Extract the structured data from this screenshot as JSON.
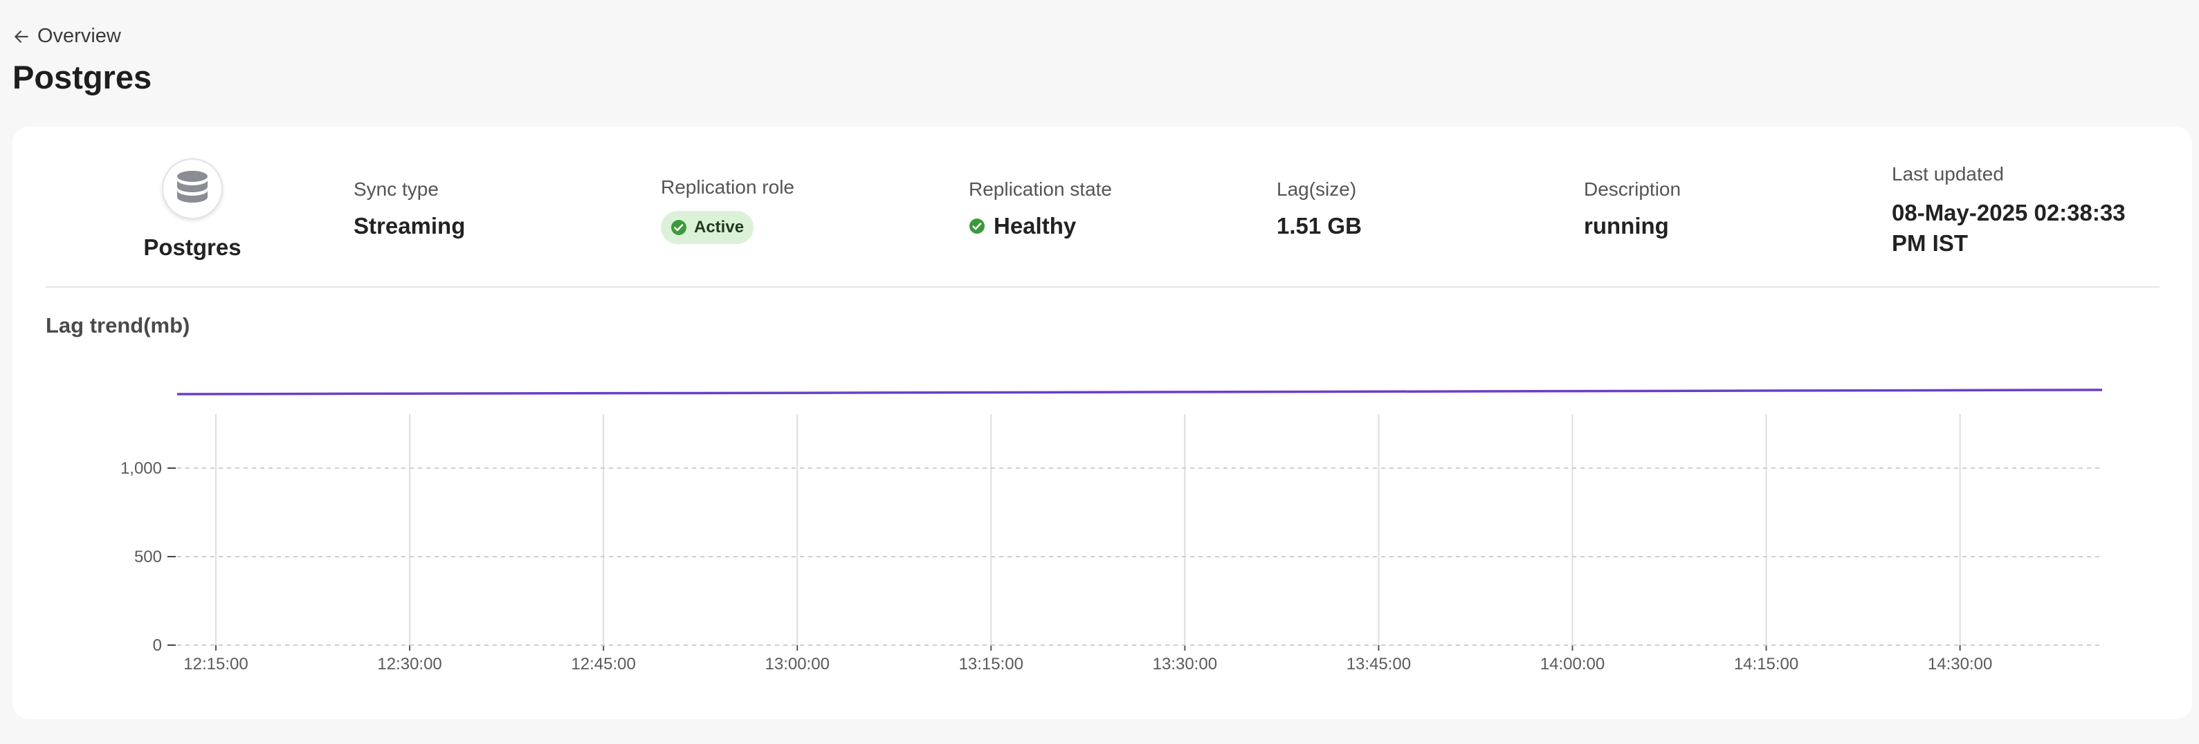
{
  "nav": {
    "back_label": "Overview"
  },
  "page": {
    "title": "Postgres"
  },
  "source": {
    "name": "Postgres",
    "icon": "database-icon"
  },
  "info": {
    "sync_type": {
      "label": "Sync type",
      "value": "Streaming"
    },
    "replication_role": {
      "label": "Replication role",
      "value": "Active",
      "color": "#2e8b3a"
    },
    "replication_state": {
      "label": "Replication state",
      "value": "Healthy",
      "color": "#2e8b3a"
    },
    "lag_size": {
      "label": "Lag(size)",
      "value": "1.51 GB"
    },
    "description": {
      "label": "Description",
      "value": "running"
    },
    "last_updated": {
      "label": "Last updated",
      "value_line1": "08-May-2025 02:38:33",
      "value_line2": "PM IST"
    }
  },
  "chart_data": {
    "type": "line",
    "title": "Lag trend(mb)",
    "xlabel": "",
    "ylabel": "",
    "x_ticks": [
      "12:15:00",
      "12:30:00",
      "12:45:00",
      "13:00:00",
      "13:15:00",
      "13:30:00",
      "13:45:00",
      "14:00:00",
      "14:15:00",
      "14:30:00"
    ],
    "y_ticks": [
      "0",
      "500",
      "1,000"
    ],
    "ylim": [
      0,
      1500
    ],
    "xlim": [
      "12:12:00",
      "14:41:00"
    ],
    "grid": true,
    "line_color": "#6a3fc6",
    "series": [
      {
        "x": [
          "12:12:00",
          "12:30:00",
          "13:00:00",
          "13:30:00",
          "14:00:00",
          "14:30:00",
          "14:41:00"
        ],
        "values": [
          1418,
          1421,
          1425,
          1430,
          1435,
          1440,
          1442
        ]
      }
    ]
  }
}
